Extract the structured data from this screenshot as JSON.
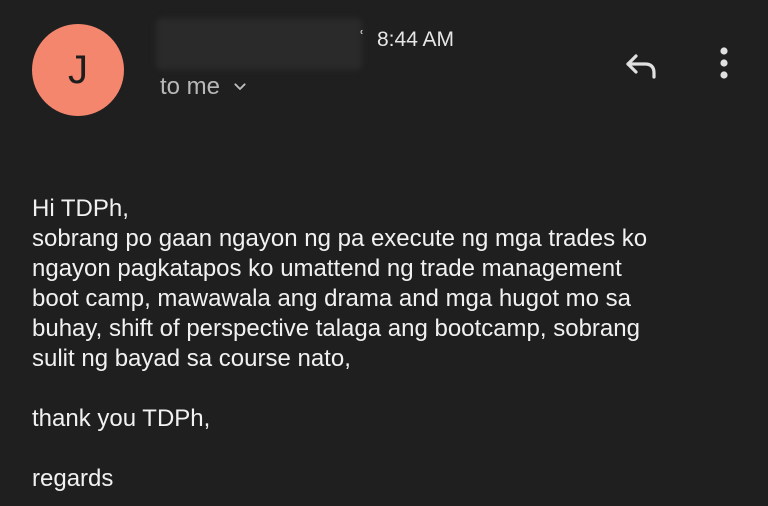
{
  "avatar": {
    "initial": "J",
    "color": "#f4866d"
  },
  "header": {
    "time_fragment": "ʿ",
    "time": "8:44 AM",
    "to_text": "to me",
    "reply_icon": "reply-icon",
    "more_icon": "more-vert-icon"
  },
  "message": {
    "greeting": "Hi TDPh,",
    "body_lines": [
      "sobrang po gaan ngayon ng pa execute ng mga trades ko",
      "ngayon pagkatapos ko umattend ng trade management",
      "boot camp, mawawala ang drama and mga hugot mo sa",
      "buhay, shift of perspective talaga ang bootcamp, sobrang",
      "sulit ng bayad sa course nato,"
    ],
    "thanks": "thank you TDPh,",
    "signoff": "regards"
  }
}
